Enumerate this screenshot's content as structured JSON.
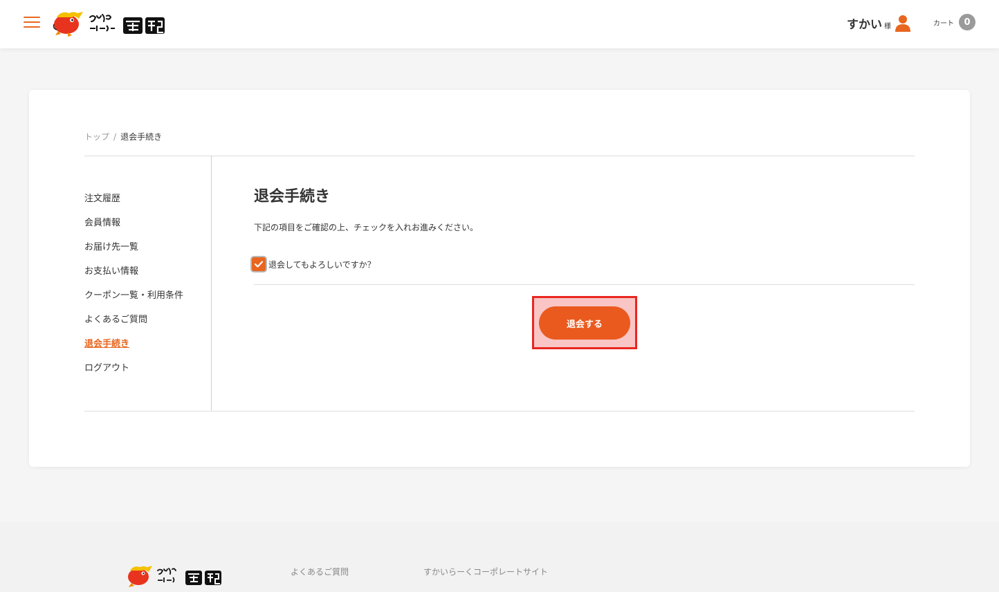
{
  "header": {
    "user_name": "すかい",
    "user_suffix": "様",
    "cart_label": "カート",
    "cart_count": "0"
  },
  "breadcrumb": {
    "home": "トップ",
    "separator": "/",
    "current": "退会手続き"
  },
  "sidebar": {
    "items": [
      {
        "label": "注文履歴"
      },
      {
        "label": "会員情報"
      },
      {
        "label": "お届け先一覧"
      },
      {
        "label": "お支払い情報"
      },
      {
        "label": "クーポン一覧・利用条件"
      },
      {
        "label": "よくあるご質問"
      },
      {
        "label": "退会手続き"
      },
      {
        "label": "ログアウト"
      }
    ]
  },
  "main": {
    "title": "退会手続き",
    "description": "下記の項目をご確認の上、チェックを入れお進みください。",
    "confirm_label": "退会してもよろしいですか？",
    "submit_label": "退会する"
  },
  "footer": {
    "faq_link": "よくあるご質問",
    "corporate_link": "すかいらーくコーポレートサイト"
  },
  "colors": {
    "accent": "#e8661f",
    "button": "#ea5a1e",
    "highlight_border": "#e8261f"
  }
}
